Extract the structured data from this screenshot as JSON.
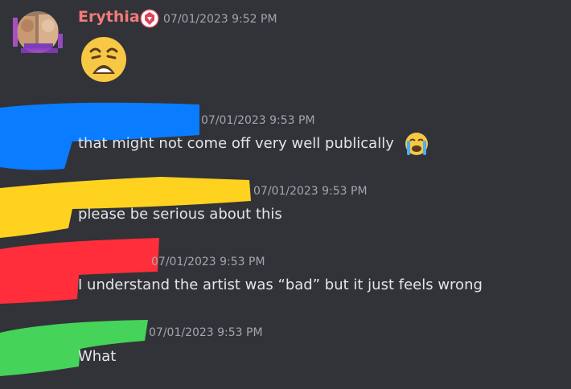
{
  "messages": [
    {
      "author": "Erythia",
      "timestamp": "07/01/2023 9:52 PM",
      "content_emoji": "weary-face-emoji",
      "author_color": "#f27a7a"
    },
    {
      "author_redaction_color": "#0a7cff",
      "timestamp": "07/01/2023 9:53 PM",
      "text": "that might not come off very well publically",
      "trailing_emoji": "loudly-crying-face-emoji"
    },
    {
      "author_redaction_color": "#ffd21f",
      "timestamp": "07/01/2023 9:53 PM",
      "text": "please be serious about this"
    },
    {
      "author_redaction_color": "#ff2e3a",
      "timestamp": "07/01/2023 9:53 PM",
      "text": "I understand the artist was “bad” but it just feels wrong"
    },
    {
      "author_redaction_color": "#45d35a",
      "timestamp": "07/01/2023 9:53 PM",
      "text": "What"
    }
  ],
  "colors": {
    "background": "#313338",
    "text": "#e3e5e8",
    "timestamp": "#a3a6ad"
  }
}
